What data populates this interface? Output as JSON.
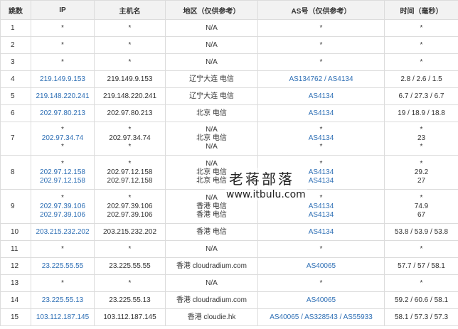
{
  "headers": {
    "hop": "跳数",
    "ip": "IP",
    "hostname": "主机名",
    "region": "地区（仅供参考）",
    "as": "AS号（仅供参考）",
    "time": "时间（毫秒）"
  },
  "rows": [
    {
      "hop": "1",
      "ip": [
        "*"
      ],
      "host": [
        "*"
      ],
      "region": [
        "N/A"
      ],
      "as": "*",
      "time": [
        "*"
      ]
    },
    {
      "hop": "2",
      "ip": [
        "*"
      ],
      "host": [
        "*"
      ],
      "region": [
        "N/A"
      ],
      "as": "*",
      "time": [
        "*"
      ]
    },
    {
      "hop": "3",
      "ip": [
        "*"
      ],
      "host": [
        "*"
      ],
      "region": [
        "N/A"
      ],
      "as": "*",
      "time": [
        "*"
      ]
    },
    {
      "hop": "4",
      "ip": [
        "219.149.9.153"
      ],
      "host": [
        "219.149.9.153"
      ],
      "region": [
        "辽宁大连 电信"
      ],
      "as": "AS134762 / AS4134",
      "time": [
        "2.8 / 2.6 / 1.5"
      ]
    },
    {
      "hop": "5",
      "ip": [
        "219.148.220.241"
      ],
      "host": [
        "219.148.220.241"
      ],
      "region": [
        "辽宁大连 电信"
      ],
      "as": "AS4134",
      "time": [
        "6.7 / 27.3 / 6.7"
      ]
    },
    {
      "hop": "6",
      "ip": [
        "202.97.80.213"
      ],
      "host": [
        "202.97.80.213"
      ],
      "region": [
        "北京 电信"
      ],
      "as": "AS4134",
      "time": [
        "19 / 18.9 / 18.8"
      ]
    },
    {
      "hop": "7",
      "ip": [
        "*",
        "202.97.34.74",
        "*"
      ],
      "host": [
        "*",
        "202.97.34.74",
        "*"
      ],
      "region": [
        "N/A",
        "北京 电信",
        "N/A"
      ],
      "as_lines": [
        "*",
        "AS4134",
        "*"
      ],
      "time": [
        "*",
        "23",
        "*"
      ]
    },
    {
      "hop": "8",
      "ip": [
        "*",
        "202.97.12.158",
        "202.97.12.158"
      ],
      "host": [
        "*",
        "202.97.12.158",
        "202.97.12.158"
      ],
      "region": [
        "N/A",
        "北京 电信",
        "北京 电信"
      ],
      "as_lines": [
        "*",
        "AS4134",
        "AS4134"
      ],
      "time": [
        "*",
        "29.2",
        "27"
      ]
    },
    {
      "hop": "9",
      "ip": [
        "*",
        "202.97.39.106",
        "202.97.39.106"
      ],
      "host": [
        "*",
        "202.97.39.106",
        "202.97.39.106"
      ],
      "region": [
        "N/A",
        "香港 电信",
        "香港 电信"
      ],
      "as_lines": [
        "*",
        "AS4134",
        "AS4134"
      ],
      "time": [
        "*",
        "74.9",
        "67"
      ]
    },
    {
      "hop": "10",
      "ip": [
        "203.215.232.202"
      ],
      "host": [
        "203.215.232.202"
      ],
      "region": [
        "香港 电信"
      ],
      "as": "AS4134",
      "time": [
        "53.8 / 53.9 / 53.8"
      ]
    },
    {
      "hop": "11",
      "ip": [
        "*"
      ],
      "host": [
        "*"
      ],
      "region": [
        "N/A"
      ],
      "as": "*",
      "time": [
        "*"
      ]
    },
    {
      "hop": "12",
      "ip": [
        "23.225.55.55"
      ],
      "host": [
        "23.225.55.55"
      ],
      "region": [
        "香港 cloudradium.com"
      ],
      "as": "AS40065",
      "time": [
        "57.7 / 57 / 58.1"
      ]
    },
    {
      "hop": "13",
      "ip": [
        "*"
      ],
      "host": [
        "*"
      ],
      "region": [
        "N/A"
      ],
      "as": "*",
      "time": [
        "*"
      ]
    },
    {
      "hop": "14",
      "ip": [
        "23.225.55.13"
      ],
      "host": [
        "23.225.55.13"
      ],
      "region": [
        "香港 cloudradium.com"
      ],
      "as": "AS40065",
      "time": [
        "59.2 / 60.6 / 58.1"
      ]
    },
    {
      "hop": "15",
      "ip": [
        "103.112.187.145"
      ],
      "host": [
        "103.112.187.145"
      ],
      "region": [
        "香港 cloudie.hk"
      ],
      "as": "AS40065 / AS328543 / AS55933",
      "time": [
        "58.1 / 57.3 / 57.3"
      ]
    }
  ],
  "watermark": {
    "line1": "老蒋部落",
    "line2": "www.itbulu.com"
  },
  "colors": {
    "link": "#2e6fb5",
    "header_bg": "#f2f2f2",
    "border": "#dcdcdc"
  }
}
